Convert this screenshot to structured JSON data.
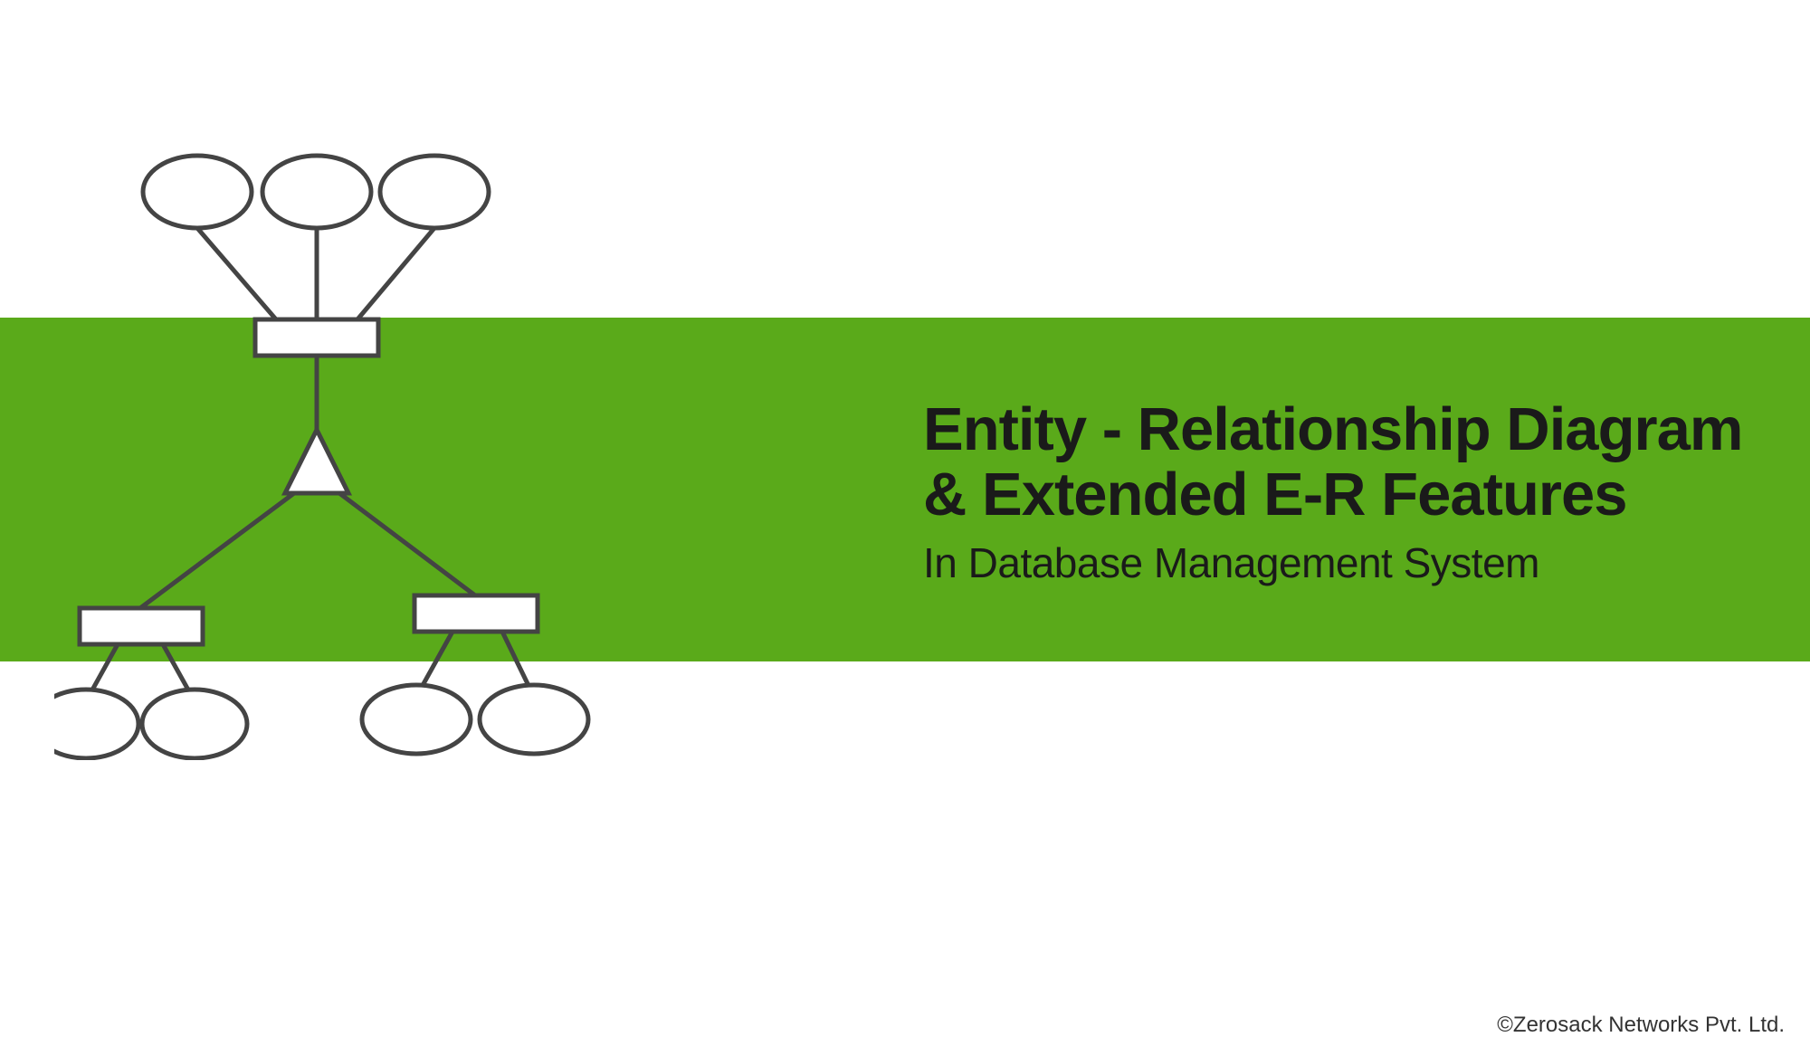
{
  "title_line1": "Entity - Relationship Diagram",
  "title_line2": "& Extended E-R Features",
  "subtitle": "In Database Management System",
  "copyright": "©Zerosack Networks Pvt. Ltd.",
  "colors": {
    "green": "#5aaa1a",
    "stroke": "#444444",
    "white": "#ffffff"
  },
  "diagram": {
    "type": "er-hierarchy",
    "top_attributes": 3,
    "top_entity": 1,
    "triangle_generalization": 1,
    "bottom_entities": 2,
    "bottom_left_attributes": 2,
    "bottom_right_attributes": 2
  }
}
